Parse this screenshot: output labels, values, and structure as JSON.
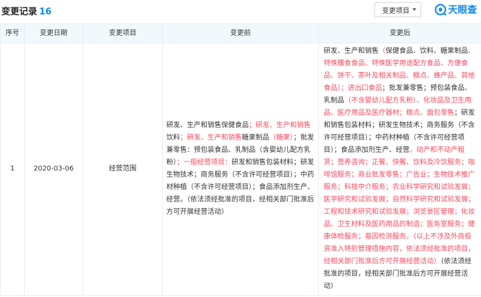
{
  "header": {
    "title": "变更记录",
    "count": "16",
    "filter_label": "变更项目",
    "logo_text": "天眼查"
  },
  "table": {
    "columns": [
      "序号",
      "变更日期",
      "变更项目",
      "变更前",
      "变更后"
    ],
    "rows": [
      {
        "index": "1",
        "date": "2020-03-06",
        "item": "经营范围",
        "before": [
          {
            "t": "研发、生产和销售保健食品",
            "h": false
          },
          {
            "t": "；研发、生产和销售",
            "h": true
          },
          {
            "t": "饮料",
            "h": false
          },
          {
            "t": "；研发、生产和销售",
            "h": true
          },
          {
            "t": "糖果制品",
            "h": false
          },
          {
            "t": "（糖果）",
            "h": true
          },
          {
            "t": "；批发兼零售：预包装食品、乳制品（含婴幼儿配方乳粉）",
            "h": false
          },
          {
            "t": "；一般经营项目：",
            "h": true
          },
          {
            "t": "研发和销售包装材料；研发生物技术；商务服务（不含许可经营项目）；中药材种植（不含许可经营项目）；食品添加剂生产、经营。（依法须经批准的项目，经相关部门批准后方可开展经营活动）",
            "h": false
          }
        ],
        "after": [
          {
            "t": "研发、生产和销售",
            "h": false
          },
          {
            "t": "（",
            "h": true
          },
          {
            "t": "保健食品、饮料、糖果制品",
            "h": false
          },
          {
            "t": "、特殊膳食食品、特殊医学用途配方食品、方便食品、饼干、茶叶及相关制品、糕点、蜂产品、其他食品）；进出口食品",
            "h": true
          },
          {
            "t": "；批发兼零售；预包装食品、乳制品",
            "h": false
          },
          {
            "t": "（不含婴幼儿配方乳粉）、化妆品及卫生用品、医疗用品及医疗器材；糕点、面包零售",
            "h": true
          },
          {
            "t": "；研发和销售包装材料；研发生物技术；商务服务（不含许可经营项目）；中药材种植（不含许可经营项目）；食品添加剂生产、经营",
            "h": false
          },
          {
            "t": "。动产和不动产租赁；营养咨询；正餐、快餐、饮料及冷饮服务；咖啡馆服务；商业批发零售；广告业；生物技术推广服务；科技中介服务；农业科学研究和试验发展；医学研究和试验发展；自然科学研究和试验发展；工程和技术研究和试验发展；浏览景区管理；化妆品、卫生材料及医药用品的制造；医务室服务；健康体检服务；基因检测服务。（以上不涉及外商投资准入特别管理措施内容，依法须经批准的项目，经相关部门批准后方可开展经营活动）",
            "h": true
          },
          {
            "t": "（依法须经批准的项目，经相关部门批准后方可开展经营活动）",
            "h": false
          }
        ]
      }
    ]
  },
  "colors": {
    "accent": "#128bed",
    "highlight": "#fd485e",
    "header_bg": "#f2f9fc",
    "border": "#e4eef6"
  }
}
